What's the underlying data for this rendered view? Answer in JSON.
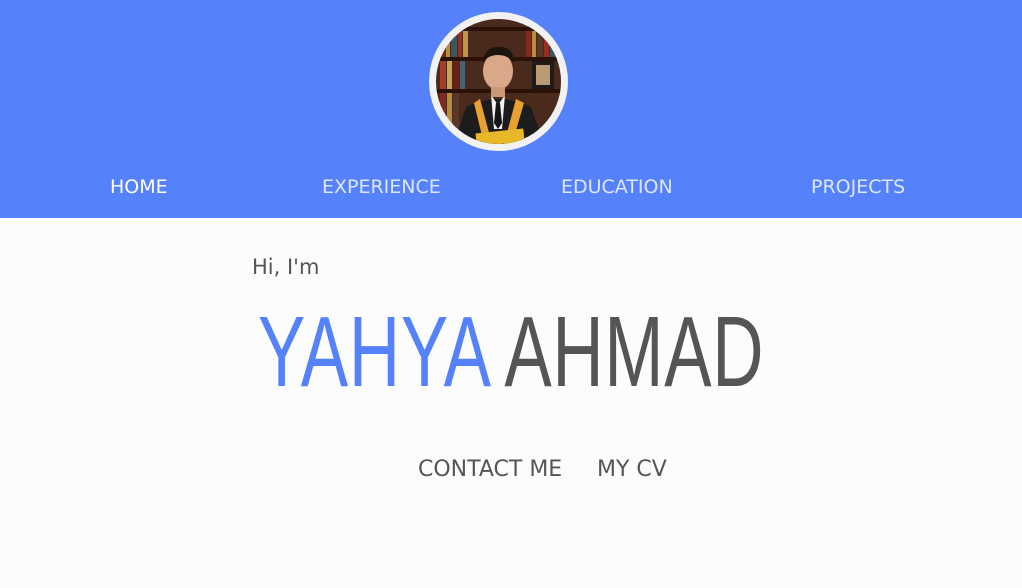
{
  "header": {
    "bg_color": "#5581fb",
    "avatar_icon": "profile-photo",
    "nav": [
      {
        "label": "HOME",
        "active": true
      },
      {
        "label": "EXPERIENCE",
        "active": false
      },
      {
        "label": "EDUCATION",
        "active": false
      },
      {
        "label": "PROJECTS",
        "active": false
      }
    ]
  },
  "hero": {
    "greeting": "Hi, I'm",
    "first_name": "YAHYA",
    "last_name": "AHMAD",
    "first_name_color": "#5581fb",
    "last_name_color": "#555555",
    "buttons": {
      "contact": "CONTACT ME",
      "cv": "MY CV"
    }
  }
}
